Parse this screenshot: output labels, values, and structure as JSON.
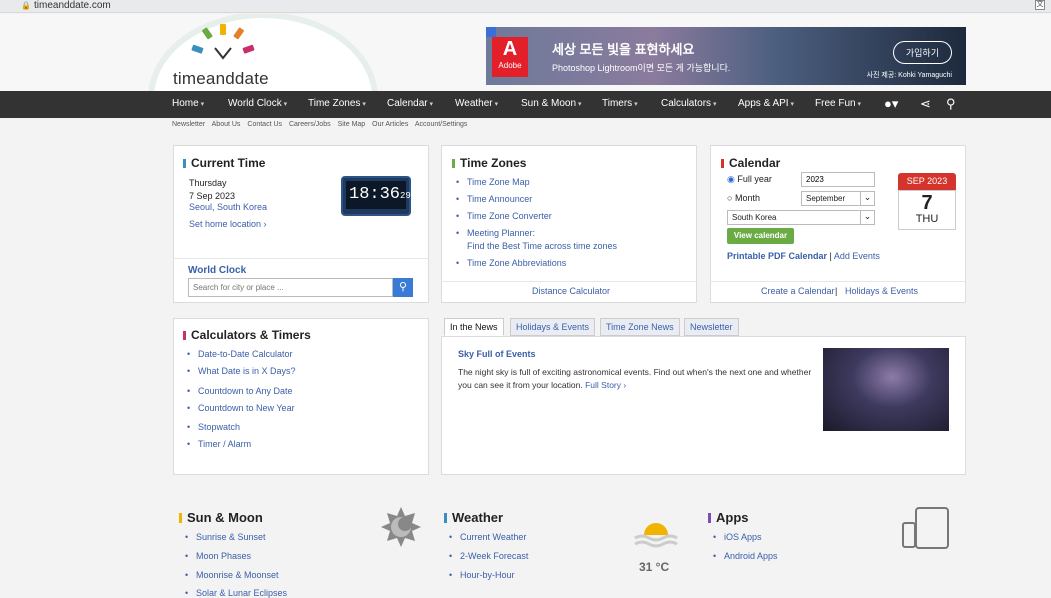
{
  "browser": {
    "url": "timeanddate.com"
  },
  "logo": {
    "text": "timeanddate"
  },
  "ad": {
    "brand": "Adobe",
    "headline": "세상 모든 빛을 표현하세요",
    "subline": "Photoshop Lightroom이면 모든 게 가능합니다.",
    "button": "가입하기",
    "caption": "사진 제공: Kohki Yamaguchi"
  },
  "nav": [
    "Home",
    "World Clock",
    "Time Zones",
    "Calendar",
    "Weather",
    "Sun & Moon",
    "Timers",
    "Calculators",
    "Apps & API",
    "Free Fun"
  ],
  "subnav": [
    "Newsletter",
    "About Us",
    "Contact Us",
    "Careers/Jobs",
    "Site Map",
    "Our Articles",
    "Account/Settings"
  ],
  "current_time": {
    "title": "Current Time",
    "day": "Thursday",
    "date": "7 Sep 2023",
    "location": "Seoul, South Korea",
    "set_home": "Set home location",
    "time": "18:36",
    "seconds": "29",
    "world_clock": "World Clock",
    "search_placeholder": "Search for city or place ..."
  },
  "time_zones": {
    "title": "Time Zones",
    "items": [
      "Time Zone Map",
      "Time Announcer",
      "Time Zone Converter",
      "Meeting Planner:",
      "Find the Best Time across time zones",
      "Time Zone Abbreviations"
    ],
    "footer": "Distance Calculator"
  },
  "calendar": {
    "title": "Calendar",
    "full_year": "Full year",
    "month": "Month",
    "year_value": "2023",
    "month_value": "September",
    "country_value": "South Korea",
    "view_btn": "View calendar",
    "pdf": "Printable PDF Calendar",
    "sep": "|",
    "add": "Add Events",
    "create": "Create a Calendar",
    "holidays": "Holidays & Events",
    "icon_month": "SEP",
    "icon_year": "2023",
    "icon_day": "7",
    "icon_dow": "THU"
  },
  "calcs": {
    "title": "Calculators & Timers",
    "items": [
      "Date-to-Date Calculator",
      "What Date is in X Days?",
      "Countdown to Any Date",
      "Countdown to New Year",
      "Stopwatch",
      "Timer / Alarm"
    ]
  },
  "news": {
    "tabs": [
      "In the News",
      "Holidays & Events",
      "Time Zone News",
      "Newsletter"
    ],
    "headline": "Sky Full of Events",
    "body1": "The night sky is full of exciting astronomical events. Find out when's the next one and whether",
    "body2": "you can see it from your location.",
    "more": "Full Story"
  },
  "sun_moon": {
    "title": "Sun & Moon",
    "items": [
      "Sunrise & Sunset",
      "Moon Phases",
      "Moonrise & Moonset",
      "Solar & Lunar Eclipses"
    ]
  },
  "weather": {
    "title": "Weather",
    "items": [
      "Current Weather",
      "2-Week Forecast",
      "Hour-by-Hour"
    ],
    "temp": "31 °C"
  },
  "apps": {
    "title": "Apps",
    "items": [
      "iOS Apps",
      "Android Apps"
    ]
  },
  "colors": {
    "nav_bg": "#333333",
    "link": "#3a5fa8",
    "accent_blue": "#3a8fbf",
    "accent_green": "#6aab44",
    "accent_red": "#d4342b",
    "accent_pink": "#c8306a",
    "accent_yellow": "#f0b400",
    "accent_purple": "#7a4fb2",
    "view_btn": "#6aab44"
  }
}
